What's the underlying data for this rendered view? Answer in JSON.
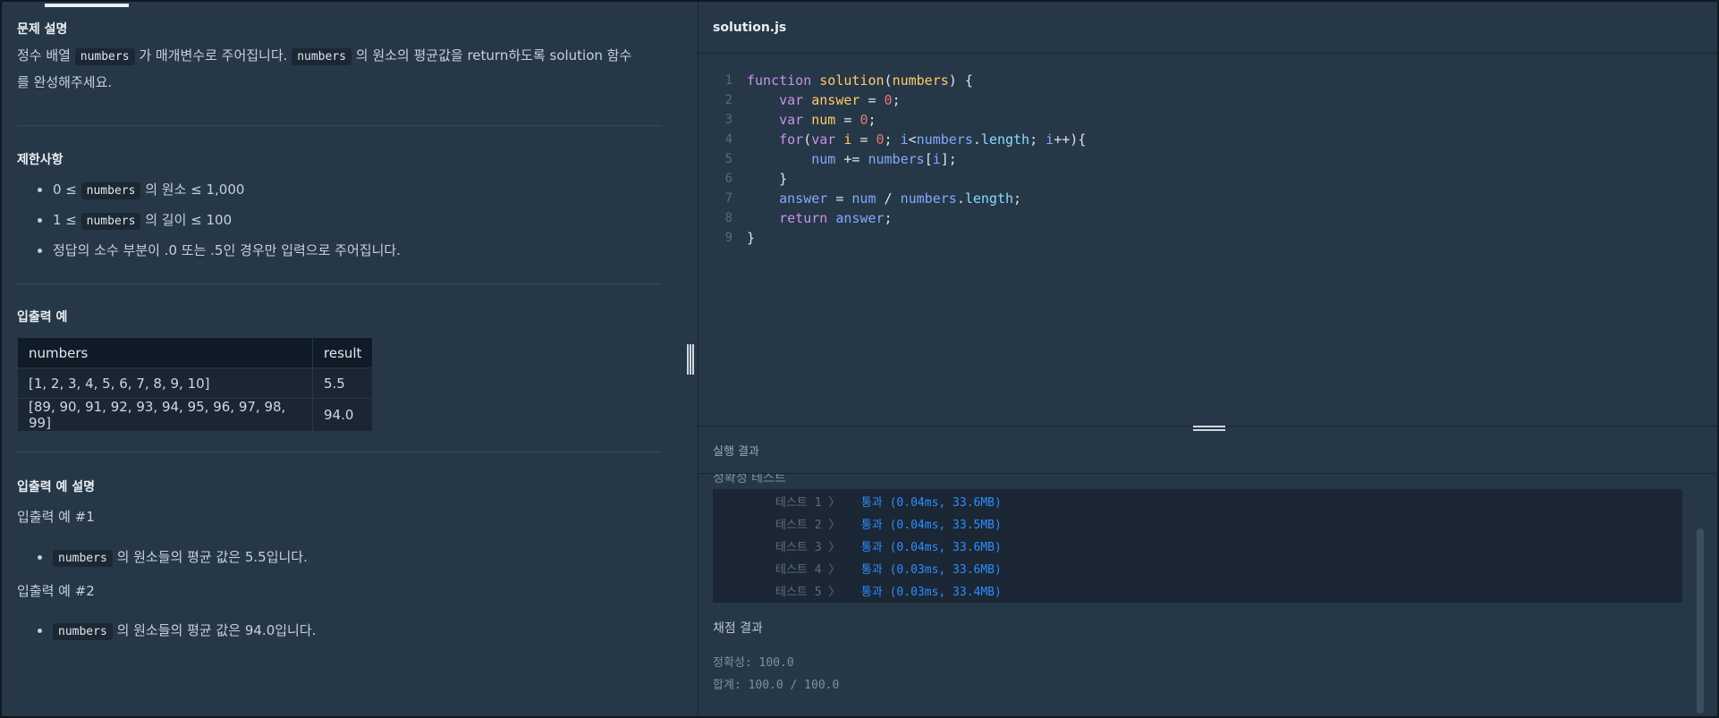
{
  "problem": {
    "description_title": "문제 설명",
    "desc_part1": "정수 배열 ",
    "desc_code1": "numbers",
    "desc_part2": " 가 매개변수로 주어집니다. ",
    "desc_code2": "numbers",
    "desc_part3": " 의 원소의 평균값을 return하도록 solution 함수",
    "desc_line2": "를 완성해주세요.",
    "constraints_title": "제한사항",
    "constraints": [
      {
        "pre": "0 ≤ ",
        "code": "numbers",
        "post": " 의 원소 ≤ 1,000"
      },
      {
        "pre": "1 ≤ ",
        "code": "numbers",
        "post": " 의 길이 ≤ 100"
      },
      {
        "pre": "정답의 소수 부분이 .0 또는 .5인 경우만 입력으로 주어집니다.",
        "code": "",
        "post": ""
      }
    ],
    "examples_title": "입출력 예",
    "table": {
      "headers": [
        "numbers",
        "result"
      ],
      "rows": [
        [
          "[1, 2, 3, 4, 5, 6, 7, 8, 9, 10]",
          "5.5"
        ],
        [
          "[89, 90, 91, 92, 93, 94, 95, 96, 97, 98, 99]",
          "94.0"
        ]
      ]
    },
    "explain_title": "입출력 예 설명",
    "ex1_title": "입출력 예 #1",
    "ex1_code": "numbers",
    "ex1_text": " 의 원소들의 평균 값은 5.5입니다.",
    "ex2_title": "입출력 예 #2",
    "ex2_code": "numbers",
    "ex2_text": " 의 원소들의 평균 값은 94.0입니다."
  },
  "editor": {
    "filename": "solution.js",
    "line_numbers": [
      "1",
      "2",
      "3",
      "4",
      "5",
      "6",
      "7",
      "8",
      "9"
    ]
  },
  "results": {
    "header": "실행 결과",
    "cut_title": "정확성  테스트",
    "tests": [
      {
        "label": "테스트 1 〉",
        "result": "통과 (0.04ms, 33.6MB)"
      },
      {
        "label": "테스트 2 〉",
        "result": "통과 (0.04ms, 33.5MB)"
      },
      {
        "label": "테스트 3 〉",
        "result": "통과 (0.04ms, 33.6MB)"
      },
      {
        "label": "테스트 4 〉",
        "result": "통과 (0.03ms, 33.6MB)"
      },
      {
        "label": "테스트 5 〉",
        "result": "통과 (0.03ms, 33.4MB)"
      }
    ],
    "grade_title": "채점 결과",
    "accuracy": "정확성: 100.0",
    "total": "합계: 100.0 / 100.0"
  }
}
